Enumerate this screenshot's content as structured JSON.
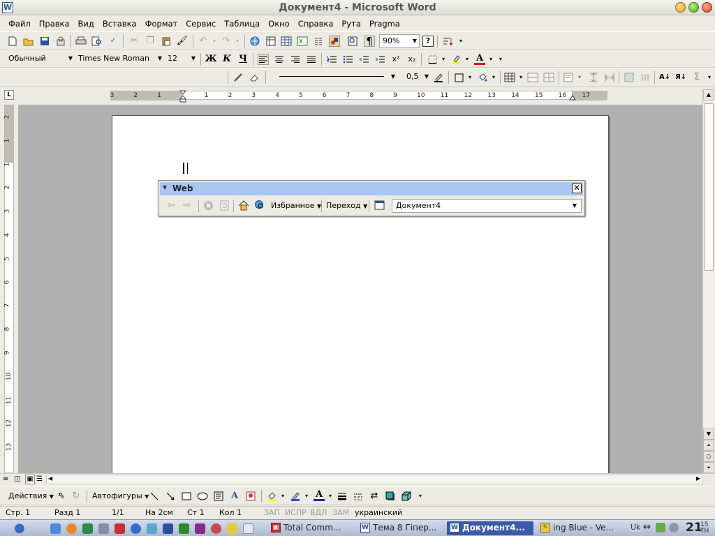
{
  "window": {
    "title": "Документ4 - Microsoft Word",
    "app_icon": "W"
  },
  "menu": [
    "Файл",
    "Правка",
    "Вид",
    "Вставка",
    "Формат",
    "Сервис",
    "Таблица",
    "Окно",
    "Справка",
    "Рута",
    "Pragma"
  ],
  "standard_toolbar": {
    "zoom": "90%",
    "pilcrow": "¶"
  },
  "formatting_toolbar": {
    "style": "Обычный",
    "font": "Times New Roman",
    "size": "12",
    "bold": "Ж",
    "italic": "К",
    "underline": "Ч"
  },
  "tables_toolbar": {
    "line_weight": "0,5"
  },
  "ruler": {
    "left_labels": [
      "3",
      "2",
      "1"
    ],
    "right_labels": [
      "1",
      "2",
      "3",
      "4",
      "5",
      "6",
      "7",
      "8",
      "9",
      "10",
      "11",
      "12",
      "13",
      "14",
      "15",
      "16",
      "17"
    ],
    "vertical_labels": [
      "2",
      "1",
      "1",
      "2",
      "3",
      "4",
      "5",
      "6",
      "7",
      "8",
      "9",
      "10",
      "11",
      "12",
      "13"
    ],
    "tab_selector": "L"
  },
  "web_toolbar": {
    "title": "Web",
    "close_glyph": "✕",
    "favorites": "Избранное",
    "go": "Переход",
    "address": "Документ4"
  },
  "drawing_toolbar": {
    "actions": "Действия",
    "autoshapes": "Автофигуры"
  },
  "status_bar": {
    "page": "Стр. 1",
    "section": "Разд 1",
    "pages": "1/1",
    "at": "На 2см",
    "line": "Ст 1",
    "col": "Кол 1",
    "rec": "ЗАП",
    "trk": "ИСПР",
    "ext": "ВДЛ",
    "ovr": "ЗАМ",
    "language": "украинский"
  },
  "taskbar": {
    "tasks": [
      {
        "label": "Total Comm...",
        "active": false
      },
      {
        "label": "Тема 8 Гіпер...",
        "active": false
      },
      {
        "label": "Документ4...",
        "active": true
      },
      {
        "label": "ing Blue - Ve...",
        "active": false
      }
    ],
    "tray_lang": "Uk",
    "clock": "21",
    "clock_minutes": "15",
    "clock_day": "ТН"
  },
  "colors": {
    "chrome": "#ebebe4",
    "workspace": "#b0b0b0",
    "web_header": "#a9c6f0",
    "task_active": "#3a5aa8"
  }
}
